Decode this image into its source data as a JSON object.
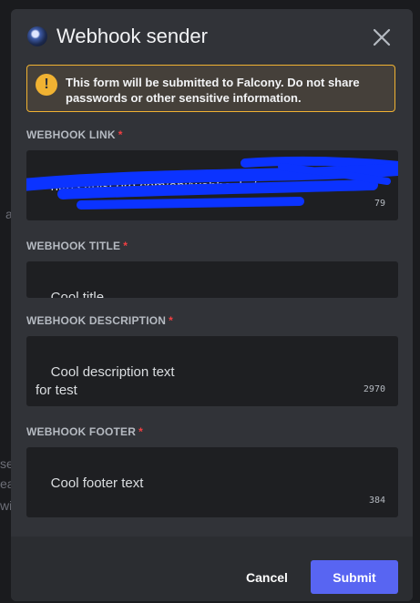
{
  "modal": {
    "title": "Webhook sender",
    "avatar_icon": "bot-avatar",
    "close_icon": "close-icon"
  },
  "notice": {
    "icon": "warning-icon",
    "prefix": "This form will be submitted to ",
    "app_name": "Falcony",
    "suffix": ". Do not share passwords or other sensitive information."
  },
  "fields": {
    "link": {
      "label": "WEBHOOK LINK",
      "required_mark": "*",
      "value": "https://discord.com/api/webhooks/",
      "remaining": "79",
      "redaction_color": "#0b33ff"
    },
    "title": {
      "label": "WEBHOOK TITLE",
      "required_mark": "*",
      "value": "Cool title"
    },
    "description": {
      "label": "WEBHOOK DESCRIPTION",
      "required_mark": "*",
      "value": "Cool description text\nfor test",
      "remaining": "2970"
    },
    "footer": {
      "label": "WEBHOOK FOOTER",
      "required_mark": "*",
      "value": "Cool footer text",
      "remaining": "384"
    }
  },
  "actions": {
    "cancel_label": "Cancel",
    "submit_label": "Submit"
  },
  "background": {
    "fragments": [
      "a",
      "se",
      "ea",
      "wi"
    ]
  },
  "colors": {
    "accent": "#5865f2",
    "warning": "#f0b232",
    "required": "#f23f42"
  }
}
